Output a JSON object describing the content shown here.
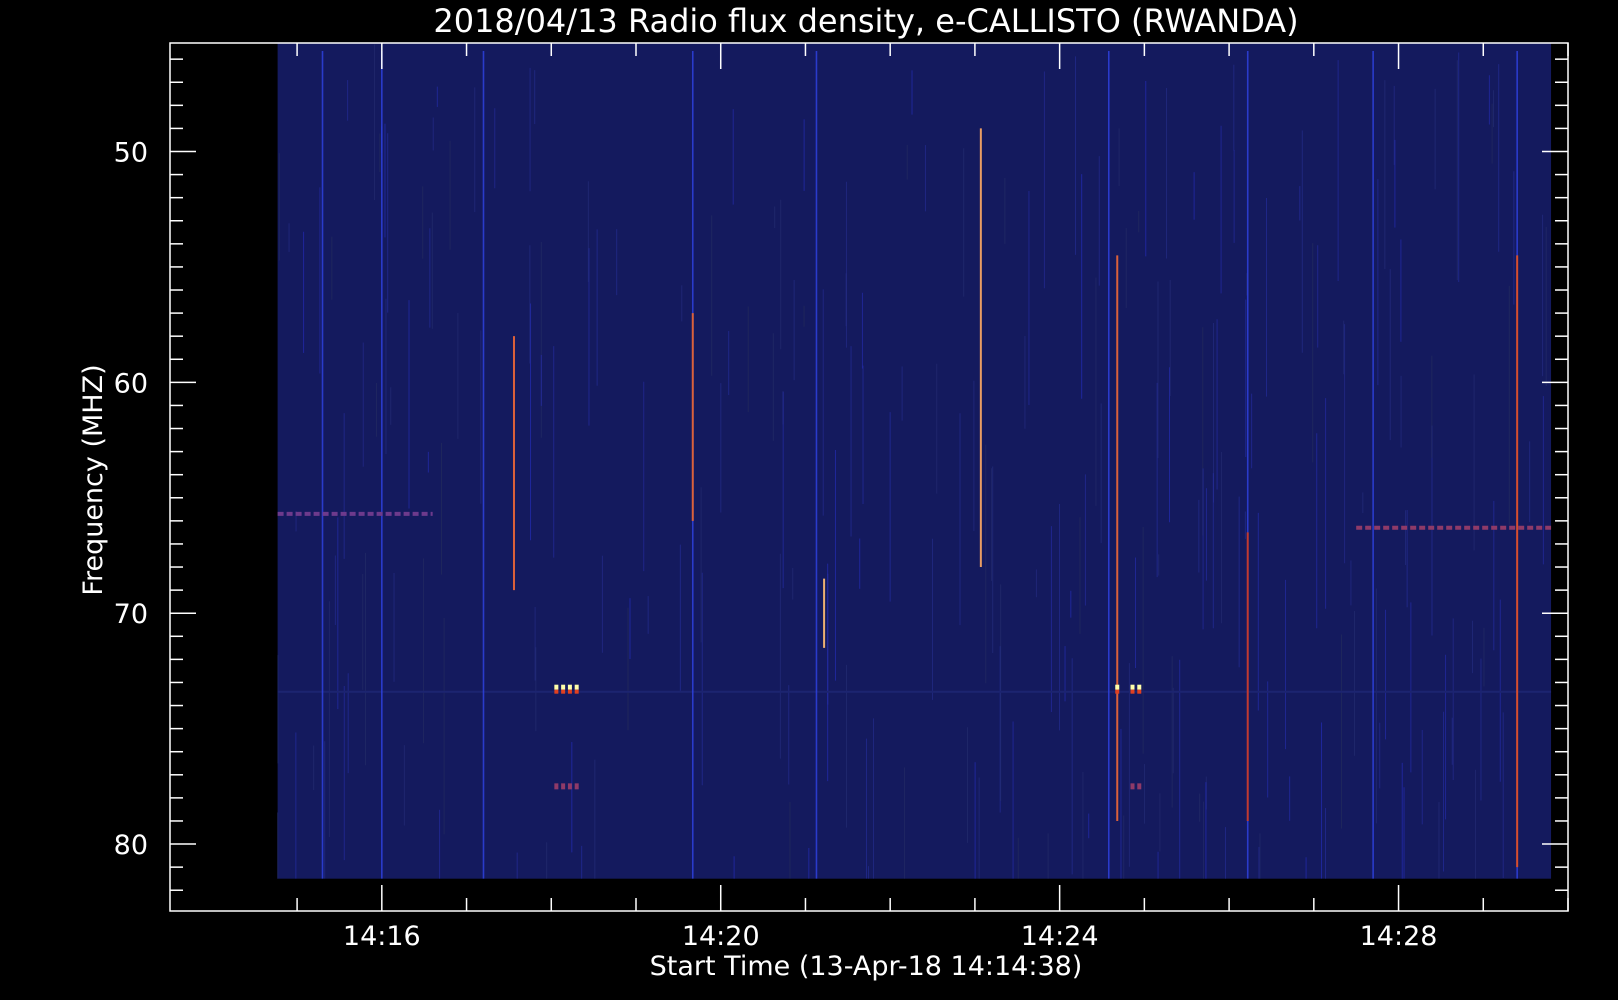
{
  "chart_data": {
    "type": "heatmap",
    "title": "2018/04/13  Radio flux density, e-CALLISTO (RWANDA)",
    "xlabel": "Start Time (13-Apr-18 14:14:38)",
    "ylabel": "Frequency (MHZ)",
    "x_unit": "minutes after 14:00",
    "xlim": [
      13.5,
      30.0
    ],
    "ylim": [
      45.3,
      82.9
    ],
    "y_inverted": true,
    "data_extent": {
      "x": [
        14.77,
        29.8
      ],
      "y": [
        45.3,
        81.5
      ]
    },
    "x_ticks": [
      {
        "value": 16,
        "label": "14:16"
      },
      {
        "value": 20,
        "label": "14:20"
      },
      {
        "value": 24,
        "label": "14:24"
      },
      {
        "value": 28,
        "label": "14:28"
      }
    ],
    "y_ticks": [
      {
        "value": 50,
        "label": "50"
      },
      {
        "value": 60,
        "label": "60"
      },
      {
        "value": 70,
        "label": "70"
      },
      {
        "value": 80,
        "label": "80"
      }
    ],
    "colormap": {
      "background": "#141a5e",
      "low": "#2a3ad6",
      "mid": "#d23a1e",
      "high": "#ffffaa"
    },
    "features": [
      {
        "name": "burst-1",
        "time": 17.56,
        "f_start": 58.0,
        "f_end": 69.0,
        "intensity": 0.6
      },
      {
        "name": "burst-2",
        "time": 19.67,
        "f_start": 57.0,
        "f_end": 66.0,
        "intensity": 0.6
      },
      {
        "name": "burst-3",
        "time": 21.22,
        "f_start": 68.5,
        "f_end": 71.5,
        "intensity": 0.8
      },
      {
        "name": "burst-4",
        "time": 23.07,
        "f_start": 49.0,
        "f_end": 68.0,
        "intensity": 0.75
      },
      {
        "name": "burst-5",
        "time": 24.68,
        "f_start": 54.5,
        "f_end": 79.0,
        "intensity": 0.6
      },
      {
        "name": "burst-6",
        "time": 26.22,
        "f_start": 66.5,
        "f_end": 79.0,
        "intensity": 0.45
      },
      {
        "name": "burst-7",
        "time": 29.4,
        "f_start": 54.5,
        "f_end": 81.0,
        "intensity": 0.55
      }
    ],
    "spots": [
      {
        "name": "rfi-cluster-1",
        "times": [
          18.06,
          18.14,
          18.22,
          18.3
        ],
        "freq": 73.4,
        "intensity": 1.0
      },
      {
        "name": "rfi-cluster-2",
        "times": [
          24.68,
          24.86,
          24.94
        ],
        "freq": 73.4,
        "intensity": 1.0
      },
      {
        "name": "rfi-echo-1",
        "times": [
          18.06,
          18.14,
          18.22,
          18.3
        ],
        "freq": 77.5,
        "intensity": 0.3
      },
      {
        "name": "rfi-echo-2",
        "times": [
          24.86,
          24.94
        ],
        "freq": 77.5,
        "intensity": 0.3
      }
    ],
    "bands": [
      {
        "name": "band-66mhz",
        "t_start": 27.5,
        "t_end": 29.8,
        "freq": 66.3,
        "intensity": 0.3
      },
      {
        "name": "band-early",
        "t_start": 14.77,
        "t_end": 16.6,
        "freq": 65.7,
        "intensity": 0.2
      }
    ]
  }
}
